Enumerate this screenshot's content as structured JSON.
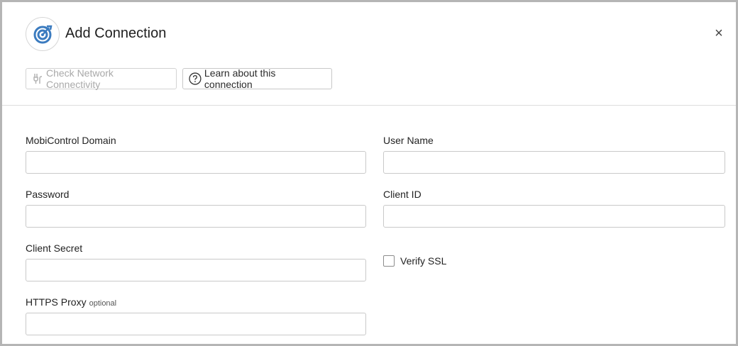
{
  "dialog": {
    "title": "Add Connection",
    "close_symbol": "×",
    "logo_icon": "mobicontrol-target-icon",
    "accent_color": "#3b7bbf"
  },
  "toolbar": {
    "check_network_label": "Check Network Connectivity",
    "check_network_icon": "network-plug-icon",
    "check_network_disabled": true,
    "learn_label": "Learn about this connection",
    "learn_icon": "help-circle-icon"
  },
  "form": {
    "mobicontrol_domain": {
      "label": "MobiControl Domain",
      "value": ""
    },
    "user_name": {
      "label": "User Name",
      "value": ""
    },
    "password": {
      "label": "Password",
      "value": ""
    },
    "client_id": {
      "label": "Client ID",
      "value": ""
    },
    "client_secret": {
      "label": "Client Secret",
      "value": ""
    },
    "verify_ssl": {
      "label": "Verify SSL",
      "checked": false
    },
    "https_proxy": {
      "label": "HTTPS Proxy",
      "optional_tag": "optional",
      "value": ""
    }
  }
}
